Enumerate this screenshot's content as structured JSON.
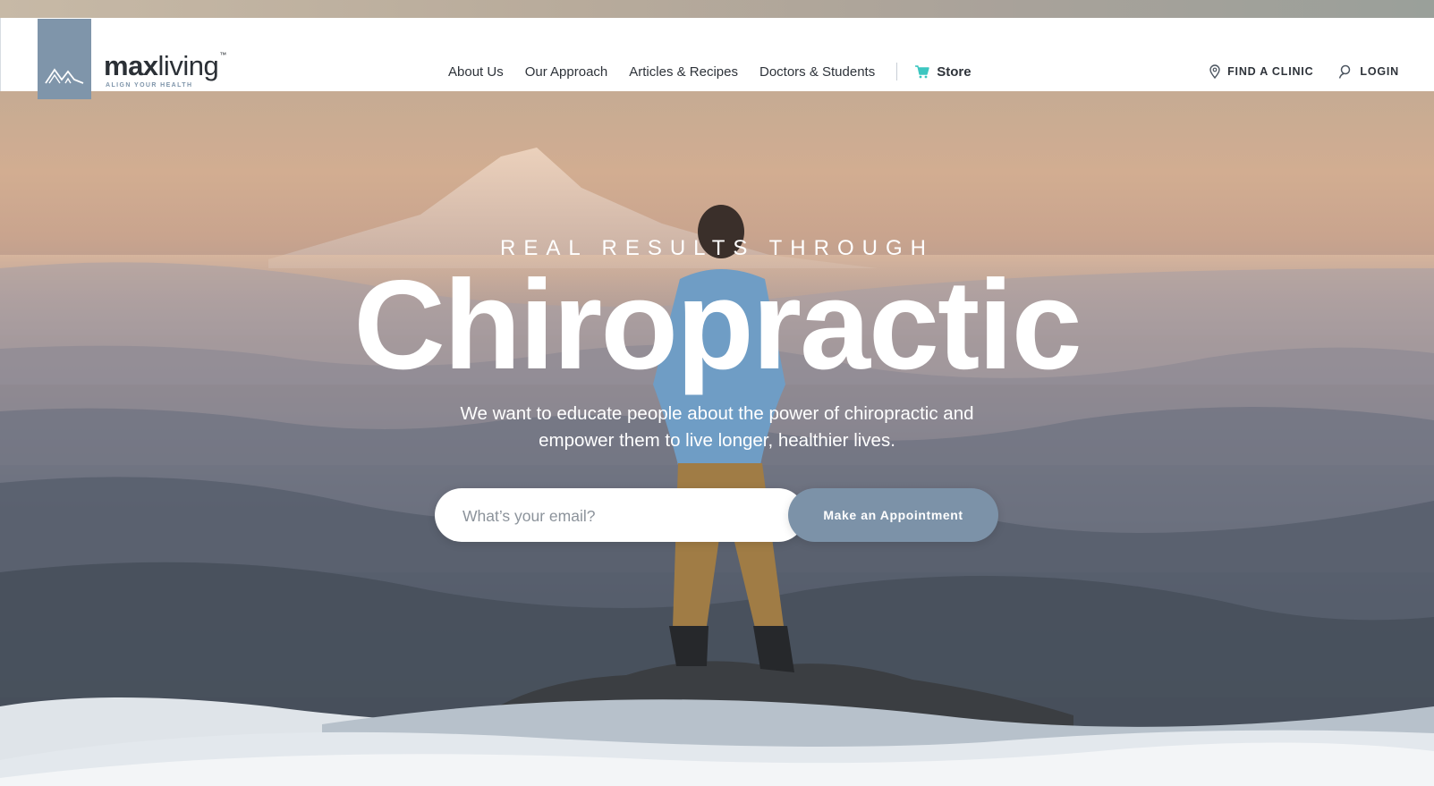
{
  "brand": {
    "name_bold": "max",
    "name_light": "living",
    "trademark": "™",
    "tagline": "ALIGN YOUR HEALTH",
    "logo_color": "#7f95aa"
  },
  "nav": {
    "links": [
      "About Us",
      "Our Approach",
      "Articles & Recipes",
      "Doctors & Students"
    ],
    "store_label": "Store",
    "store_icon": "cart-icon",
    "store_icon_color": "#3cc6c0",
    "find_clinic_label": "FIND A CLINIC",
    "find_clinic_icon": "map-pin-icon",
    "login_label": "LOGIN",
    "login_icon": "user-icon"
  },
  "hero": {
    "eyebrow": "REAL RESULTS THROUGH",
    "headline": "Chiropractic",
    "subtext_line1": "We want to educate people about the power of chiropractic and",
    "subtext_line2": "empower them to live longer, healthier lives.",
    "email_placeholder": "What’s your email?",
    "email_value": "",
    "cta_label": "Make an Appointment",
    "cta_color": "#7c92a8"
  }
}
